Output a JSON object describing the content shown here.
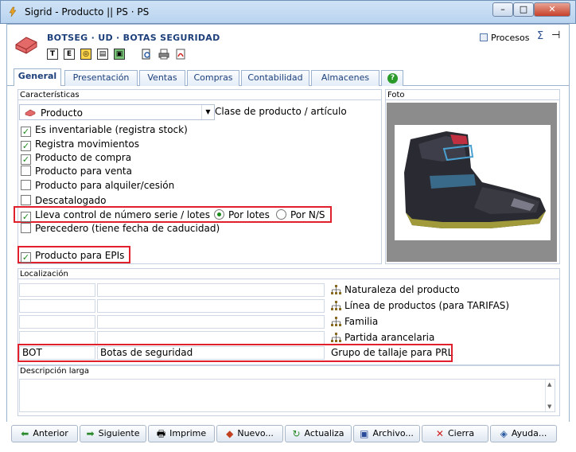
{
  "window": {
    "title": "Sigrid - Producto || PS · PS",
    "min_label": "–",
    "max_label": "□",
    "close_label": "✕"
  },
  "header": {
    "title": "BOTSEG · UD · BOTAS SEGURIDAD",
    "procesos_label": "Procesos",
    "sigma": "Σ",
    "pin": "⊣"
  },
  "toolbar_icons": [
    "T",
    "E",
    "◎",
    "▤",
    "▣"
  ],
  "tabs": [
    "General",
    "Presentación",
    "Ventas",
    "Compras",
    "Contabilidad",
    "Almacenes"
  ],
  "caracteristicas": {
    "legend": "Características",
    "product_type": "Producto",
    "product_type_label": "Clase de producto / artículo",
    "checks": [
      {
        "label": "Es inventariable (registra stock)",
        "checked": true
      },
      {
        "label": "Registra movimientos",
        "checked": true
      },
      {
        "label": "Producto de compra",
        "checked": true
      },
      {
        "label": "Producto para venta",
        "checked": false
      },
      {
        "label": "Producto para alquiler/cesión",
        "checked": false
      },
      {
        "label": "Descatalogado",
        "checked": false
      },
      {
        "label": "Lleva control de número serie / lotes",
        "checked": true
      },
      {
        "label": "Perecedero (tiene fecha de caducidad)",
        "checked": false
      }
    ],
    "radio_lotes": "Por lotes",
    "radio_ns": "Por N/S",
    "epis": {
      "label": "Producto para EPIs",
      "checked": true
    }
  },
  "foto": {
    "legend": "Foto"
  },
  "localizacion": {
    "legend": "Localización",
    "rows": [
      {
        "code": "",
        "name": "",
        "label": "Naturaleza del producto"
      },
      {
        "code": "",
        "name": "",
        "label": "Línea de productos (para TARIFAS)"
      },
      {
        "code": "",
        "name": "",
        "label": "Familia"
      },
      {
        "code": "",
        "name": "",
        "label": "Partida arancelaria"
      },
      {
        "code": "BOT",
        "name": "Botas de seguridad",
        "label": "Grupo de tallaje para PRL"
      }
    ]
  },
  "descripcion": {
    "legend": "Descripción larga",
    "value": ""
  },
  "buttons": [
    "Anterior",
    "Siguiente",
    "Imprime",
    "Nuevo...",
    "Actualiza",
    "Archivo...",
    "Cierra",
    "Ayuda..."
  ],
  "colors": {
    "accent": "#1d3f7a",
    "highlight_border": "#e0202a",
    "check_green": "#1a8a1a"
  }
}
